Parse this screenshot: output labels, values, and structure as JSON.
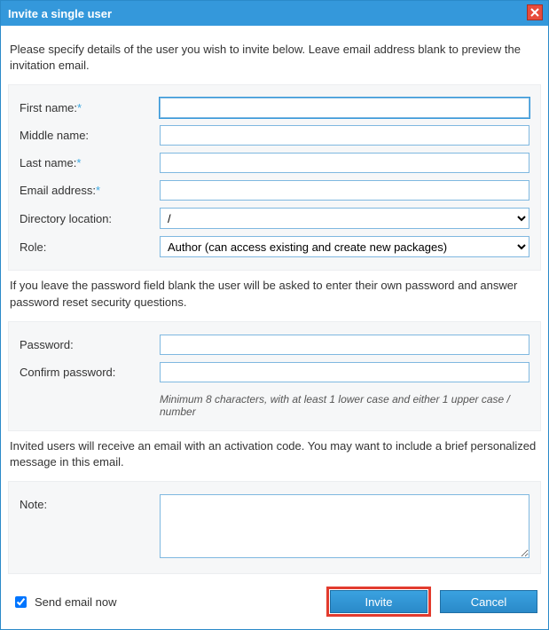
{
  "dialog": {
    "title": "Invite a single user"
  },
  "intro": "Please specify details of the user you wish to invite below. Leave email address blank to preview the invitation email.",
  "fields": {
    "first_name": {
      "label": "First name:",
      "required": true,
      "value": ""
    },
    "middle_name": {
      "label": "Middle name:",
      "required": false,
      "value": ""
    },
    "last_name": {
      "label": "Last name:",
      "required": true,
      "value": ""
    },
    "email": {
      "label": "Email address:",
      "required": true,
      "value": ""
    },
    "directory": {
      "label": "Directory location:",
      "value": "/",
      "options": [
        "/"
      ]
    },
    "role": {
      "label": "Role:",
      "value": "Author (can access existing and create new packages)",
      "options": [
        "Author (can access existing and create new packages)"
      ]
    }
  },
  "password_intro": "If you leave the password field blank the user will be asked to enter their own password and answer password reset security questions.",
  "password": {
    "label": "Password:",
    "value": ""
  },
  "confirm_password": {
    "label": "Confirm password:",
    "value": ""
  },
  "password_hint": "Minimum 8 characters, with at least 1 lower case and either 1 upper case / number",
  "note_intro": "Invited users will receive an email with an activation code. You may want to include a brief personalized message in this email.",
  "note": {
    "label": "Note:",
    "value": ""
  },
  "send_email": {
    "label": "Send email now",
    "checked": true
  },
  "buttons": {
    "invite": "Invite",
    "cancel": "Cancel"
  }
}
